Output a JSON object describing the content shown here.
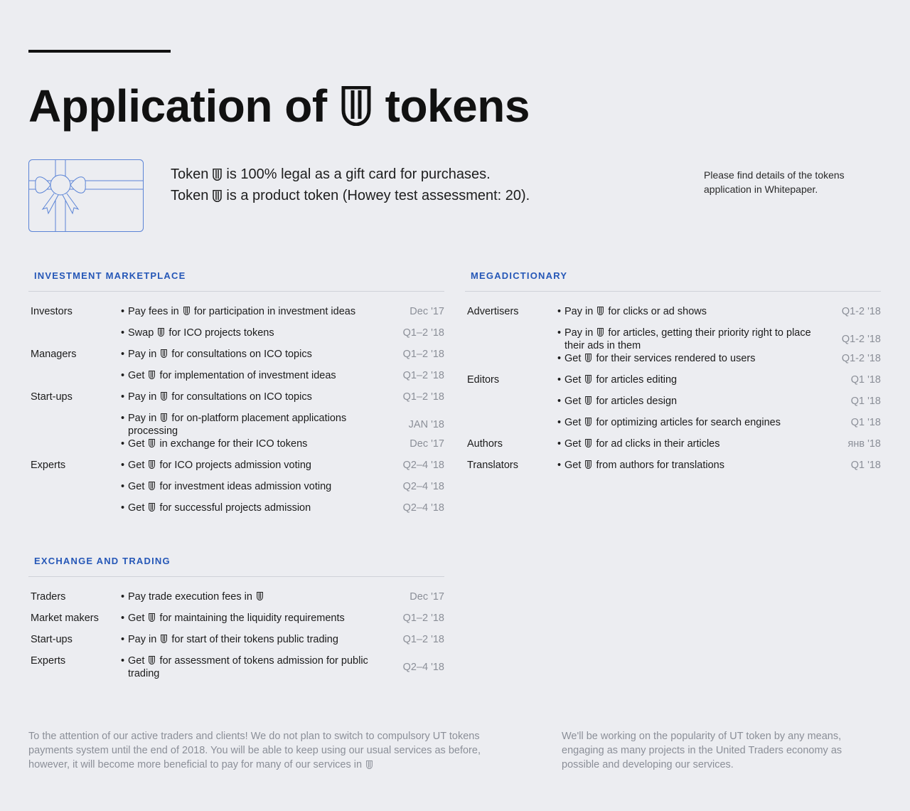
{
  "title": {
    "before": "Application of",
    "after": "tokens"
  },
  "lead": {
    "line1_before": "Token",
    "line1_after": "is 100% legal as a gift card for purchases.",
    "line2_before": "Token",
    "line2_after": "is a product token (Howey test assessment: 20)."
  },
  "aside": "Please find details of the tokens application in Whitepaper.",
  "icons": {
    "token": "ut-token-icon",
    "gift_card": "gift-card-icon"
  },
  "colors": {
    "background": "#ecedf1",
    "accent": "#2557b7",
    "icon_line": "#5b84d6",
    "date": "#8b8f98"
  },
  "investment": {
    "title": "INVESTMENT MARKETPLACE",
    "rows": [
      {
        "role": "Investors",
        "pre": "Pay fees in",
        "post": "for participation in investment ideas",
        "date": "Dec '17"
      },
      {
        "role": "",
        "pre": "Swap",
        "post": "for ICO projects tokens",
        "date": "Q1–2 '18"
      },
      {
        "role": "Managers",
        "pre": "Pay in",
        "post": "for consultations on ICO topics",
        "date": "Q1–2 '18"
      },
      {
        "role": "",
        "pre": "Get",
        "post": "for implementation of investment ideas",
        "date": "Q1–2 '18"
      },
      {
        "role": "Start-ups",
        "pre": "Pay in",
        "post": "for consultations on ICO topics",
        "date": "Q1–2 '18"
      },
      {
        "role": "",
        "pre": "Pay in",
        "post": "for on-platform placement applications processing",
        "date": "JAN '18"
      },
      {
        "role": "",
        "pre": "Get",
        "post": "in exchange for their ICO tokens",
        "date": "Dec '17"
      },
      {
        "role": "Experts",
        "pre": "Get",
        "post": "for ICO projects admission voting",
        "date": "Q2–4 '18"
      },
      {
        "role": "",
        "pre": "Get",
        "post": "for investment ideas admission voting",
        "date": "Q2–4 '18"
      },
      {
        "role": "",
        "pre": "Get",
        "post": "for successful projects admission",
        "date": "Q2–4 '18"
      }
    ]
  },
  "exchange": {
    "title": "EXCHANGE AND TRADING",
    "rows": [
      {
        "role": "Traders",
        "pre": "Pay trade execution fees in",
        "post": "",
        "date": "Dec '17"
      },
      {
        "role": "Market makers",
        "pre": "Get",
        "post": "for maintaining the liquidity requirements",
        "date": "Q1–2 '18"
      },
      {
        "role": "Start-ups",
        "pre": "Pay in",
        "post": "for start of their tokens public trading",
        "date": "Q1–2 '18"
      },
      {
        "role": "Experts",
        "pre": "Get",
        "post": "for assessment of tokens admission for public trading",
        "date": "Q2–4 '18"
      }
    ]
  },
  "megadictionary": {
    "title": "MEGADICTIONARY",
    "rows": [
      {
        "role": "Advertisers",
        "pre": "Pay in",
        "post": "for clicks or ad shows",
        "date": "Q1-2 '18"
      },
      {
        "role": "",
        "pre": "Pay in",
        "post": "for articles, getting their priority right to place their ads in them",
        "date": "Q1-2 '18"
      },
      {
        "role": "",
        "pre": "Get",
        "post": "for their services rendered to users",
        "date": "Q1-2 '18"
      },
      {
        "role": "Editors",
        "pre": "Get",
        "post": "for articles editing",
        "date": "Q1 '18"
      },
      {
        "role": "",
        "pre": "Get",
        "post": "for articles design",
        "date": "Q1 '18"
      },
      {
        "role": "",
        "pre": "Get",
        "post": "for optimizing articles for search engines",
        "date": "Q1 '18"
      },
      {
        "role": "Authors",
        "pre": "Get",
        "post": "for ad clicks in their articles",
        "date": "янв '18"
      },
      {
        "role": "Translators",
        "pre": "Get",
        "post": "from authors for translations",
        "date": "Q1 '18"
      }
    ]
  },
  "footer": {
    "left": "To the attention of our active traders and clients! We do not plan to switch to compulsory UT tokens payments system until the end of 2018. You will be able to keep using our usual services as before, however, it will become more beneficial to pay for many of our services in",
    "right": "We'll be working on the popularity of UT token by any means, engaging as many projects in the United Traders economy as possible and developing our services."
  }
}
